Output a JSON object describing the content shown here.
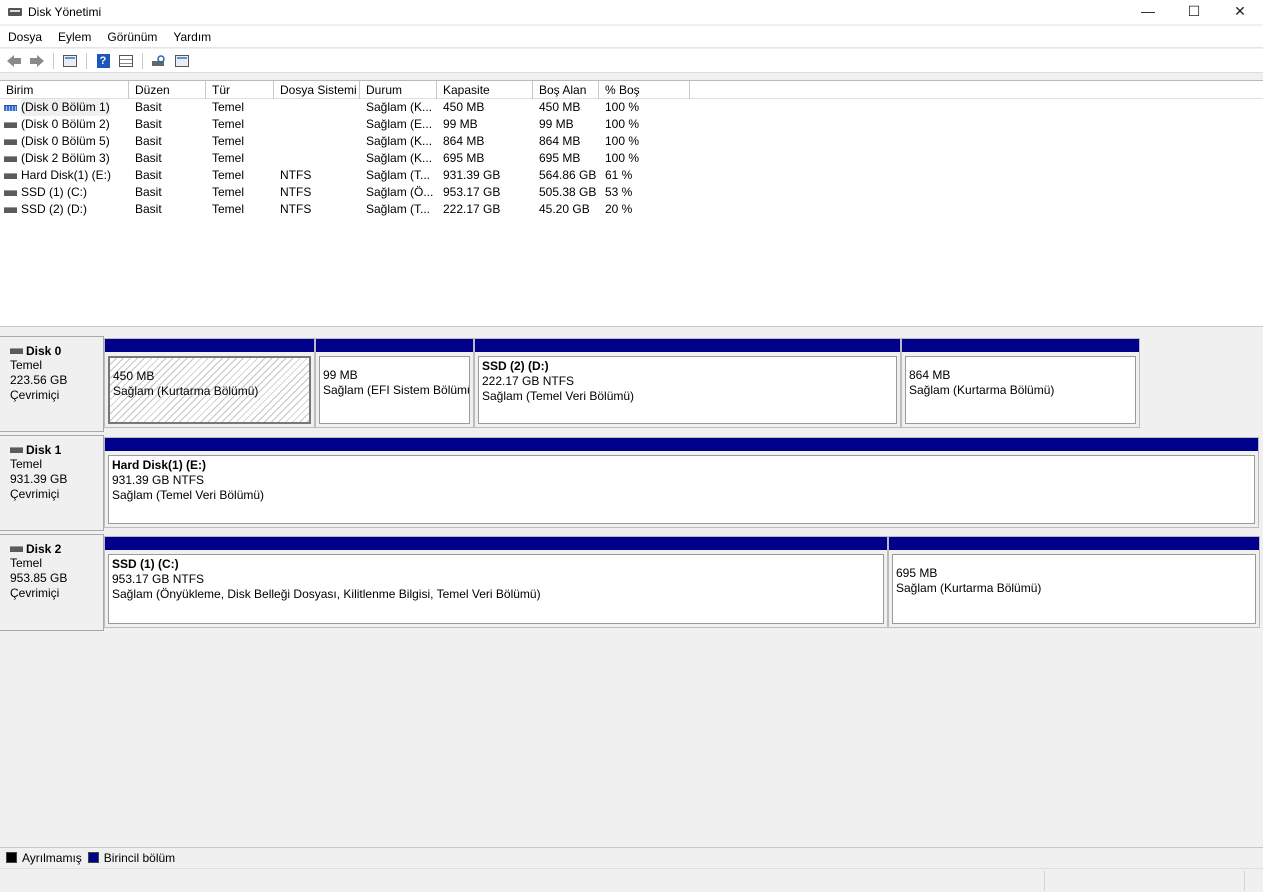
{
  "window": {
    "title": "Disk Yönetimi",
    "min_symbol": "—",
    "max_symbol": "☐",
    "close_symbol": "✕"
  },
  "menu": [
    {
      "label": "Dosya"
    },
    {
      "label": "Eylem"
    },
    {
      "label": "Görünüm"
    },
    {
      "label": "Yardım"
    }
  ],
  "toolbar": {
    "back_icon": "arrow-left-icon",
    "forward_icon": "arrow-right-icon"
  },
  "volume_list": {
    "columns": [
      "Birim",
      "Düzen",
      "Tür",
      "Dosya Sistemi",
      "Durum",
      "Kapasite",
      "Boş Alan",
      "% Boş"
    ],
    "rows": [
      {
        "name": "(Disk 0 Bölüm 1)",
        "layout": "Basit",
        "type": "Temel",
        "fs": "",
        "status": "Sağlam (K...",
        "capacity": "450 MB",
        "free": "450 MB",
        "pct": "100 %",
        "icon": "blue"
      },
      {
        "name": "(Disk 0 Bölüm 2)",
        "layout": "Basit",
        "type": "Temel",
        "fs": "",
        "status": "Sağlam (E...",
        "capacity": "99 MB",
        "free": "99 MB",
        "pct": "100 %",
        "icon": "gray"
      },
      {
        "name": "(Disk 0 Bölüm 5)",
        "layout": "Basit",
        "type": "Temel",
        "fs": "",
        "status": "Sağlam (K...",
        "capacity": "864 MB",
        "free": "864 MB",
        "pct": "100 %",
        "icon": "gray"
      },
      {
        "name": "(Disk 2 Bölüm 3)",
        "layout": "Basit",
        "type": "Temel",
        "fs": "",
        "status": "Sağlam (K...",
        "capacity": "695 MB",
        "free": "695 MB",
        "pct": "100 %",
        "icon": "gray"
      },
      {
        "name": "Hard Disk(1) (E:)",
        "layout": "Basit",
        "type": "Temel",
        "fs": "NTFS",
        "status": "Sağlam (T...",
        "capacity": "931.39 GB",
        "free": "564.86 GB",
        "pct": "61 %",
        "icon": "gray"
      },
      {
        "name": "SSD (1) (C:)",
        "layout": "Basit",
        "type": "Temel",
        "fs": "NTFS",
        "status": "Sağlam (Ö...",
        "capacity": "953.17 GB",
        "free": "505.38 GB",
        "pct": "53 %",
        "icon": "gray"
      },
      {
        "name": "SSD (2) (D:)",
        "layout": "Basit",
        "type": "Temel",
        "fs": "NTFS",
        "status": "Sağlam (T...",
        "capacity": "222.17 GB",
        "free": "45.20 GB",
        "pct": "20 %",
        "icon": "gray"
      }
    ]
  },
  "disks": [
    {
      "name": "Disk 0",
      "type": "Temel",
      "size": "223.56 GB",
      "state": "Çevrimiçi",
      "partitions": [
        {
          "title": "",
          "line1": "450 MB",
          "line2": "Sağlam (Kurtarma Bölümü)",
          "hatched": true
        },
        {
          "title": "",
          "line1": "99 MB",
          "line2": "Sağlam (EFI Sistem Bölümü)",
          "hatched": false
        },
        {
          "title": "SSD (2)  (D:)",
          "line1": "222.17 GB NTFS",
          "line2": "Sağlam (Temel Veri Bölümü)",
          "hatched": false
        },
        {
          "title": "",
          "line1": "864 MB",
          "line2": "Sağlam (Kurtarma Bölümü)",
          "hatched": false
        }
      ]
    },
    {
      "name": "Disk 1",
      "type": "Temel",
      "size": "931.39 GB",
      "state": "Çevrimiçi",
      "partitions": [
        {
          "title": "Hard Disk(1)  (E:)",
          "line1": "931.39 GB NTFS",
          "line2": "Sağlam (Temel Veri Bölümü)",
          "hatched": false
        }
      ]
    },
    {
      "name": "Disk 2",
      "type": "Temel",
      "size": "953.85 GB",
      "state": "Çevrimiçi",
      "partitions": [
        {
          "title": "SSD (1)  (C:)",
          "line1": "953.17 GB NTFS",
          "line2": "Sağlam (Önyükleme, Disk Belleği Dosyası, Kilitlenme Bilgisi, Temel Veri Bölümü)",
          "hatched": false
        },
        {
          "title": "",
          "line1": "695 MB",
          "line2": "Sağlam (Kurtarma Bölümü)",
          "hatched": false
        }
      ]
    }
  ],
  "legend": [
    {
      "label": "Ayrılmamış",
      "color": "#000000"
    },
    {
      "label": "Birincil bölüm",
      "color": "#00008b"
    }
  ]
}
